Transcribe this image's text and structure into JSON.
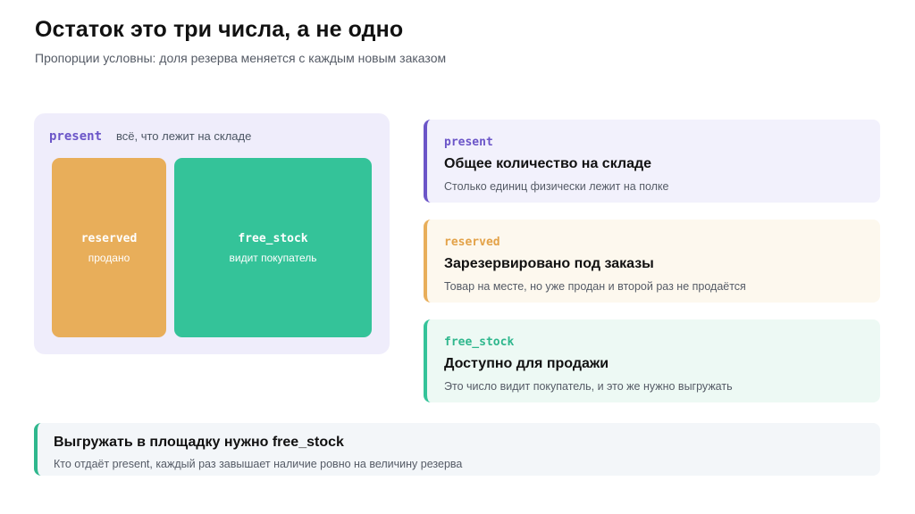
{
  "header": {
    "title": "Остаток это три числа, а не одно",
    "subtitle": "Пропорции условны: доля резерва меняется с каждым новым заказом"
  },
  "diagram": {
    "present_key": "present",
    "present_desc": "всё, что лежит на складе",
    "reserved_key": "reserved",
    "reserved_label": "продано",
    "free_key": "free_stock",
    "free_label": "видит покупатель"
  },
  "cards": [
    {
      "key": "present",
      "title": "Общее количество на складе",
      "desc": "Столько единиц физически лежит на полке"
    },
    {
      "key": "reserved",
      "title": "Зарезервировано под заказы",
      "desc": "Товар на месте, но уже продан и второй раз не продаётся"
    },
    {
      "key": "free_stock",
      "title": "Доступно для продажи",
      "desc": "Это число видит покупатель, и это же нужно выгружать"
    }
  ],
  "note": {
    "title": "Выгружать в площадку нужно free_stock",
    "desc": "Кто отдаёт present, каждый раз завышает наличие ровно на величину резерва"
  },
  "colors": {
    "present": "#6b55c8",
    "reserved": "#e8ae5a",
    "free_stock": "#34c399"
  }
}
